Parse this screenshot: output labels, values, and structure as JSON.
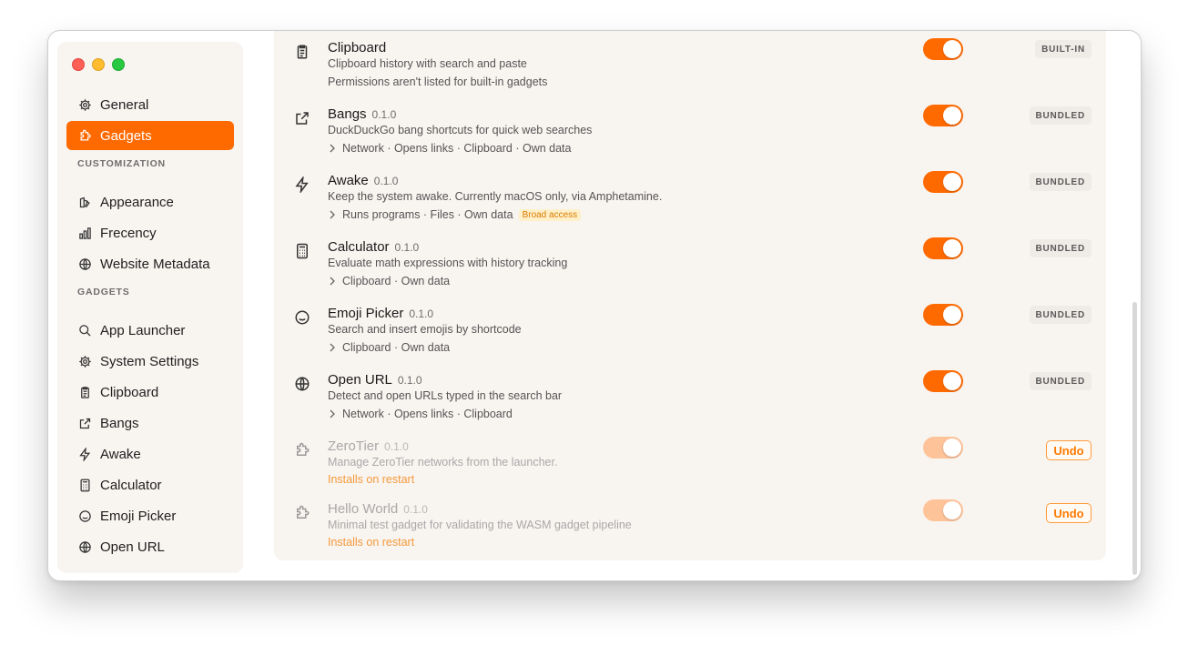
{
  "window": {
    "traffic_lights": [
      "close",
      "minimize",
      "zoom"
    ],
    "accent_color": "#ff6a00"
  },
  "sidebar": {
    "top_items": [
      {
        "label": "General",
        "icon": "gear-icon",
        "active": false
      },
      {
        "label": "Gadgets",
        "icon": "puzzle-icon",
        "active": true
      }
    ],
    "sections": [
      {
        "title": "CUSTOMIZATION",
        "items": [
          {
            "label": "Appearance",
            "icon": "appearance-icon"
          },
          {
            "label": "Frecency",
            "icon": "bar-chart-icon"
          },
          {
            "label": "Website Metadata",
            "icon": "globe-icon"
          }
        ]
      },
      {
        "title": "GADGETS",
        "items": [
          {
            "label": "App Launcher",
            "icon": "search-icon"
          },
          {
            "label": "System Settings",
            "icon": "gear-icon"
          },
          {
            "label": "Clipboard",
            "icon": "clipboard-icon"
          },
          {
            "label": "Bangs",
            "icon": "external-link-icon"
          },
          {
            "label": "Awake",
            "icon": "lightning-icon"
          },
          {
            "label": "Calculator",
            "icon": "calculator-icon"
          },
          {
            "label": "Emoji Picker",
            "icon": "smiley-icon"
          },
          {
            "label": "Open URL",
            "icon": "globe-icon"
          }
        ]
      }
    ]
  },
  "gadgets": [
    {
      "name": "Clipboard",
      "version": "",
      "icon": "clipboard-icon",
      "description": "Clipboard history with search and paste",
      "note": "Permissions aren't listed for built-in gadgets",
      "permissions": "",
      "broad_access": "",
      "enabled": true,
      "badge": "BUILT-IN",
      "pending": false
    },
    {
      "name": "Bangs",
      "version": "0.1.0",
      "icon": "external-link-icon",
      "description": "DuckDuckGo bang shortcuts for quick web searches",
      "note": "",
      "permissions": "Network · Opens links · Clipboard · Own data",
      "broad_access": "",
      "enabled": true,
      "badge": "BUNDLED",
      "pending": false
    },
    {
      "name": "Awake",
      "version": "0.1.0",
      "icon": "lightning-icon",
      "description": "Keep the system awake. Currently macOS only, via Amphetamine.",
      "note": "",
      "permissions": "Runs programs · Files · Own data",
      "broad_access": "Broad access",
      "enabled": true,
      "badge": "BUNDLED",
      "pending": false
    },
    {
      "name": "Calculator",
      "version": "0.1.0",
      "icon": "calculator-icon",
      "description": "Evaluate math expressions with history tracking",
      "note": "",
      "permissions": "Clipboard · Own data",
      "broad_access": "",
      "enabled": true,
      "badge": "BUNDLED",
      "pending": false
    },
    {
      "name": "Emoji Picker",
      "version": "0.1.0",
      "icon": "smiley-icon",
      "description": "Search and insert emojis by shortcode",
      "note": "",
      "permissions": "Clipboard · Own data",
      "broad_access": "",
      "enabled": true,
      "badge": "BUNDLED",
      "pending": false
    },
    {
      "name": "Open URL",
      "version": "0.1.0",
      "icon": "globe-icon",
      "description": "Detect and open URLs typed in the search bar",
      "note": "",
      "permissions": "Network · Opens links · Clipboard",
      "broad_access": "",
      "enabled": true,
      "badge": "BUNDLED",
      "pending": false
    },
    {
      "name": "ZeroTier",
      "version": "0.1.0",
      "icon": "puzzle-icon",
      "description": "Manage ZeroTier networks from the launcher.",
      "status": "Installs on restart",
      "enabled": true,
      "action": "Undo",
      "pending": true
    },
    {
      "name": "Hello World",
      "version": "0.1.0",
      "icon": "puzzle-icon",
      "description": "Minimal test gadget for validating the WASM gadget pipeline",
      "status": "Installs on restart",
      "enabled": true,
      "action": "Undo",
      "pending": true
    }
  ]
}
